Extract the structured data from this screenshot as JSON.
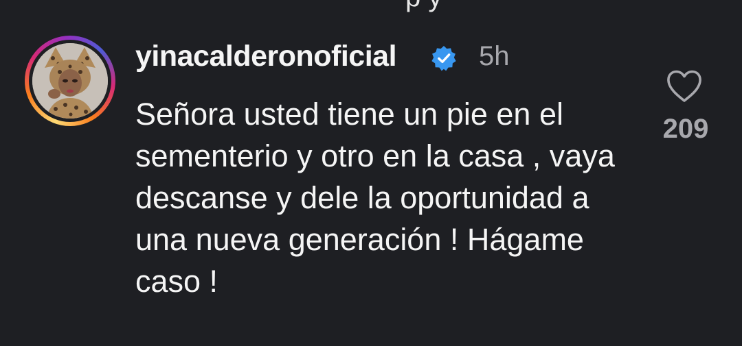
{
  "comment": {
    "username": "yinacalderonoficial",
    "verified_icon": "verified-badge-icon",
    "time": "5h",
    "text": "Señora usted tiene un pie en el sementerio y otro en la casa , vaya descanse y dele la oportunidad a una nueva generación ! Hágame caso !",
    "likes": "209",
    "like_icon": "heart-outline-icon"
  },
  "colors": {
    "background": "#1e1f23",
    "text": "#f5f5f5",
    "muted": "#a8a8ad",
    "verified": "#3897f0"
  }
}
